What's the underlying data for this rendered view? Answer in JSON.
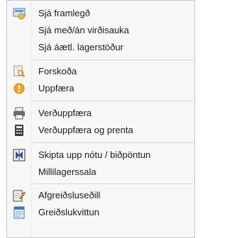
{
  "menu": {
    "items": [
      {
        "label": "Sjá framlegð",
        "icon": "money-calculator-icon"
      },
      {
        "label": "Sjá með/án virðisauka",
        "icon": ""
      },
      {
        "label": "Sjá áætl. lagerstöður",
        "icon": ""
      },
      {
        "label": "Forskoða",
        "icon": "print-preview-icon"
      },
      {
        "label": "Uppfæra",
        "icon": "warning-icon"
      },
      {
        "label": "Verðuppfæra",
        "icon": "printer-icon"
      },
      {
        "label": "Verðuppfæra og prenta",
        "icon": "calculator-icon"
      },
      {
        "label": "Skipta upp nótu / biðpöntun",
        "icon": "split-icon"
      },
      {
        "label": "Millilagerssala",
        "icon": ""
      },
      {
        "label": "Afgreiðsluseðill",
        "icon": "edit-document-icon"
      },
      {
        "label": "Greiðslukvittun",
        "icon": "receipt-icon"
      }
    ]
  }
}
